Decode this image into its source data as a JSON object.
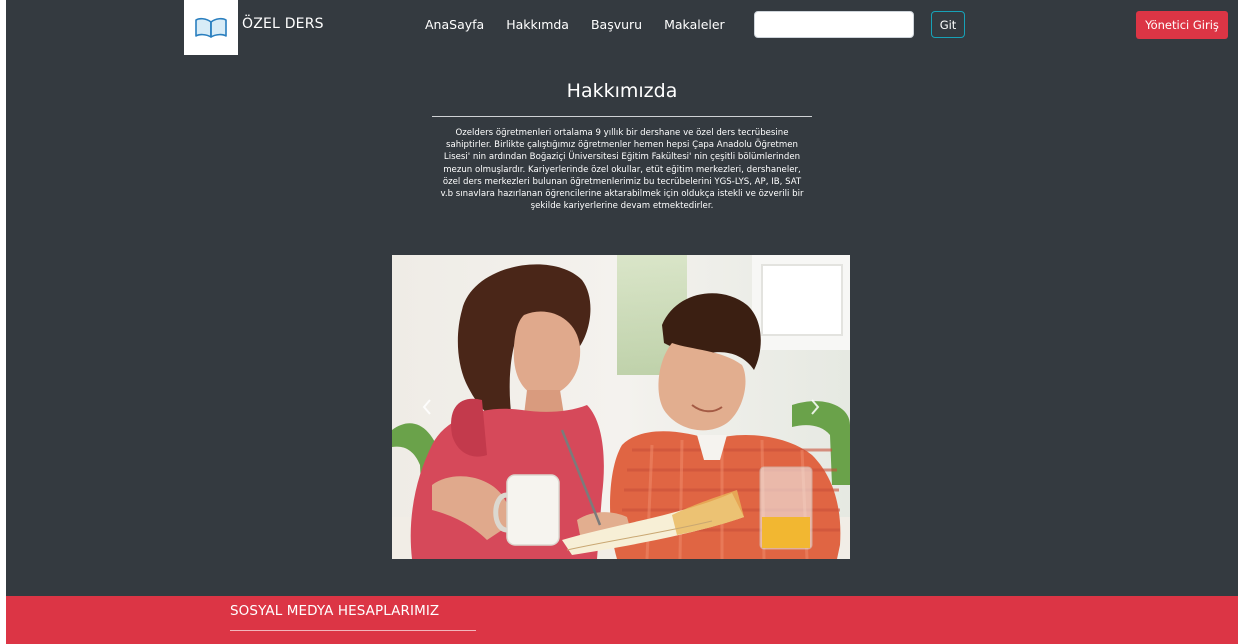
{
  "brand": {
    "name": "ÖZEL DERS",
    "logo_icon": "open-book-icon"
  },
  "nav": {
    "items": [
      "AnaSayfa",
      "Hakkımda",
      "Başvuru",
      "Makaleler"
    ]
  },
  "search": {
    "value": "",
    "placeholder": "",
    "button_label": "Git"
  },
  "admin": {
    "button_label": "Yönetici Giriş"
  },
  "about": {
    "title": "Hakkımızda",
    "body": "Ozelders öğretmenleri ortalama 9 yıllık bir dershane ve özel ders tecrübesine sahiptirler. Birlikte çalıştığımız öğretmenler hemen hepsi Çapa Anadolu Öğretmen Lisesi' nin ardından Boğaziçi Üniversitesi Eğitim Fakültesi' nin çeşitli bölümlerinden mezun olmuşlardır. Kariyerlerinde özel okullar, etüt eğitim merkezleri, dershaneler, özel ders merkezleri bulunan öğretmenlerimiz bu tecrübelerini YGS-LYS, AP, IB, SAT v.b sınavlara hazırlanan öğrencilerine aktarabilmek için oldukça istekli ve özverili bir şekilde kariyerlerine devam etmektedirler."
  },
  "carousel": {
    "prev_icon": "chevron-left-icon",
    "next_icon": "chevron-right-icon"
  },
  "footer": {
    "title": "SOSYAL MEDYA HESAPLARIMIZ"
  },
  "colors": {
    "background": "#343a40",
    "accent_red": "#dc3545",
    "search_button_border": "#17a2b8"
  }
}
